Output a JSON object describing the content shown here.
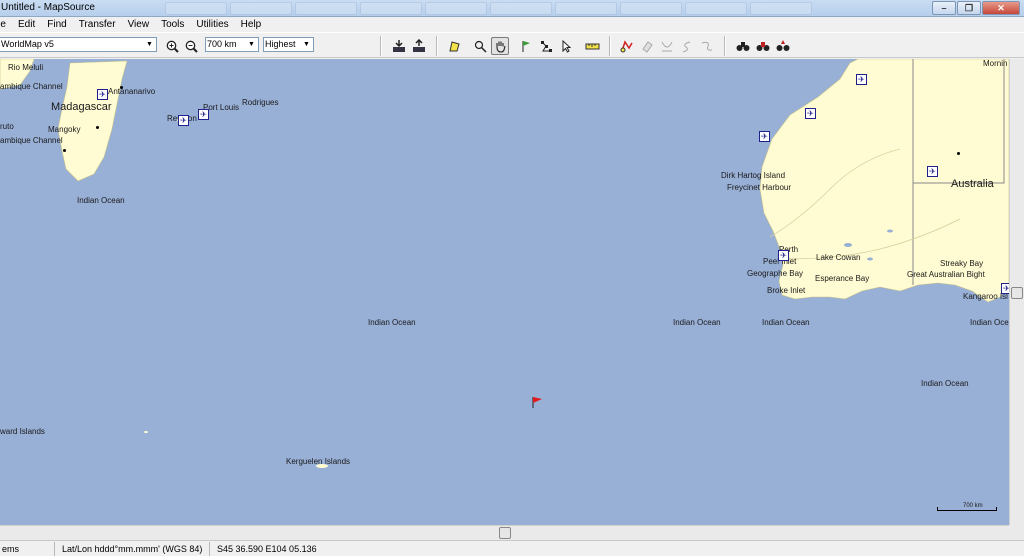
{
  "window": {
    "title": "Untitled - MapSource",
    "minimize": "–",
    "maximize": "❐",
    "close": "✕"
  },
  "menu": [
    "File",
    "Edit",
    "Find",
    "Transfer",
    "View",
    "Tools",
    "Utilities",
    "Help"
  ],
  "toolbar": {
    "map_product": "WorldMap v5",
    "zoom_scale": "700 km",
    "detail_level": "Highest"
  },
  "map": {
    "labels": {
      "rio_meluli": "Rio Meluli",
      "mozambique_channel_1": "ambique Channel",
      "madagascar": "Madagascar",
      "antananarivo": "Antananarivo",
      "toliara": "ruto",
      "mangoky": "Mangoky",
      "mozambique_channel_2": "ambique Channel",
      "port_louis": "Port Louis",
      "rodrigues": "Rodrigues",
      "reunion": "Reunion",
      "indian_ocean_1": "Indian Ocean",
      "indian_ocean_2": "Indian Ocean",
      "indian_ocean_3": "Indian Ocean",
      "indian_ocean_4": "Indian Ocean",
      "indian_ocean_5": "Indian Ocean",
      "indian_ocean_6": "Indian Ocean",
      "indian_ocean_7": "Indian Oce",
      "heard_islands": "ward Islands",
      "kerguelen": "Kerguelen Islands",
      "dirk_hartog": "Dirk Hartog Island",
      "freycinet": "Freycinet Harbour",
      "perth": "Perth",
      "peel_inlet": "Peel Inlet",
      "geographe_bay": "Geographe Bay",
      "broke_inlet": "Broke Inlet",
      "lake_cowan": "Lake Cowan",
      "esperance_bay": "Esperance Bay",
      "streaky_bay": "Streaky Bay",
      "great_australian_bight": "Great Australian Bight",
      "kangaroo_island": "Kangaroo Isl",
      "australia": "Australia",
      "mornington": "Mornin"
    },
    "scale_label": "700 km",
    "flag_color": "#e01b1b"
  },
  "status": {
    "selection": "ems Selected",
    "position_format": "Lat/Lon hddd°mm.mmm' (WGS 84)",
    "coordinates": "S45 36.590 E104 05.136"
  }
}
